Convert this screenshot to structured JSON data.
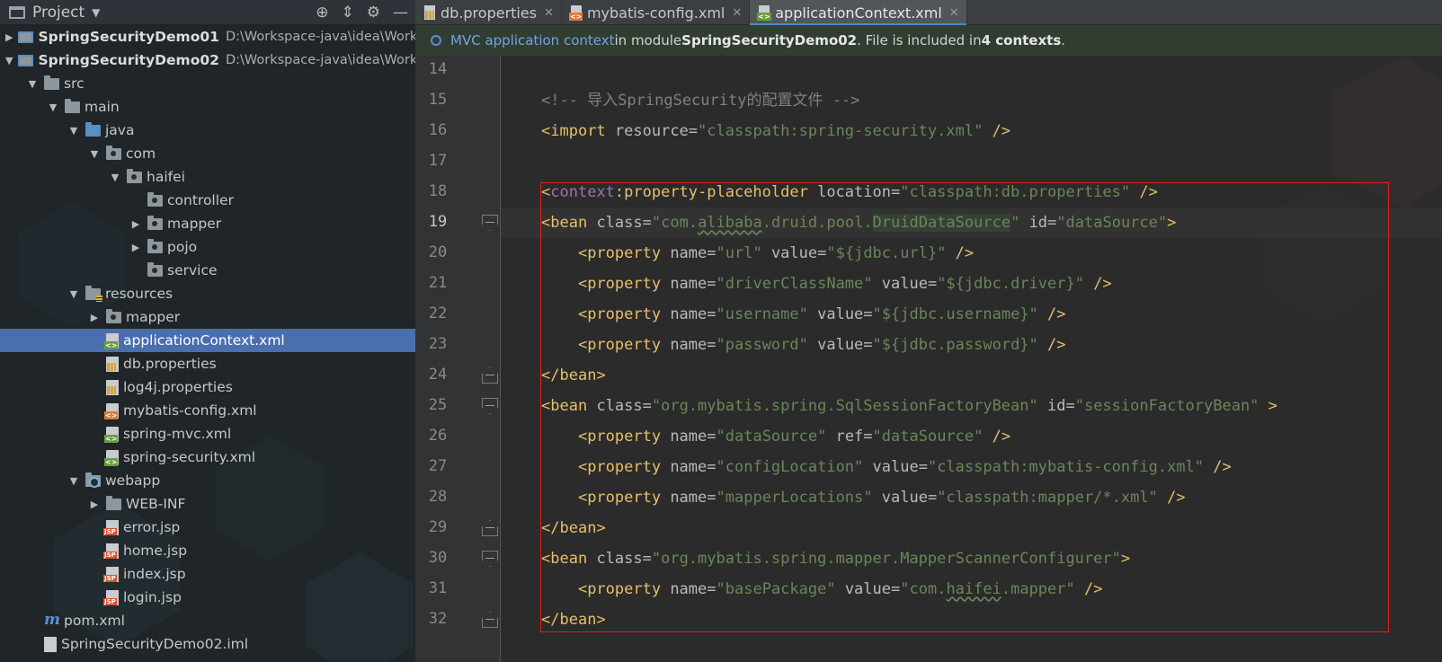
{
  "project_panel": {
    "header_label": "Project",
    "tree": [
      {
        "label": "SpringSecurityDemo01",
        "path": "D:\\Workspace-java\\idea\\Worksp",
        "bold": true,
        "depth": 0,
        "arrow": "right",
        "icon": "module-folder-icon"
      },
      {
        "label": "SpringSecurityDemo02",
        "path": "D:\\Workspace-java\\idea\\Worksp",
        "bold": true,
        "depth": 0,
        "arrow": "down",
        "icon": "module-folder-icon"
      },
      {
        "label": "src",
        "depth": 1,
        "arrow": "down",
        "icon": "folder-icon"
      },
      {
        "label": "main",
        "depth": 2,
        "arrow": "down",
        "icon": "folder-icon"
      },
      {
        "label": "java",
        "depth": 3,
        "arrow": "down",
        "icon": "source-folder-icon"
      },
      {
        "label": "com",
        "depth": 4,
        "arrow": "down",
        "icon": "package-icon"
      },
      {
        "label": "haifei",
        "depth": 5,
        "arrow": "down",
        "icon": "package-icon"
      },
      {
        "label": "controller",
        "depth": 6,
        "arrow": "none",
        "icon": "package-icon"
      },
      {
        "label": "mapper",
        "depth": 6,
        "arrow": "right",
        "icon": "package-icon"
      },
      {
        "label": "pojo",
        "depth": 6,
        "arrow": "right",
        "icon": "package-icon"
      },
      {
        "label": "service",
        "depth": 6,
        "arrow": "none",
        "icon": "package-icon"
      },
      {
        "label": "resources",
        "depth": 3,
        "arrow": "down",
        "icon": "resources-folder-icon"
      },
      {
        "label": "mapper",
        "depth": 4,
        "arrow": "right",
        "icon": "package-icon"
      },
      {
        "label": "applicationContext.xml",
        "depth": 4,
        "arrow": "none",
        "icon": "spring-xml-file-icon",
        "selected": true
      },
      {
        "label": "db.properties",
        "depth": 4,
        "arrow": "none",
        "icon": "properties-file-icon"
      },
      {
        "label": "log4j.properties",
        "depth": 4,
        "arrow": "none",
        "icon": "properties-file-icon"
      },
      {
        "label": "mybatis-config.xml",
        "depth": 4,
        "arrow": "none",
        "icon": "xml-file-icon"
      },
      {
        "label": "spring-mvc.xml",
        "depth": 4,
        "arrow": "none",
        "icon": "spring-xml-file-icon"
      },
      {
        "label": "spring-security.xml",
        "depth": 4,
        "arrow": "none",
        "icon": "spring-xml-file-icon"
      },
      {
        "label": "webapp",
        "depth": 3,
        "arrow": "down",
        "icon": "web-folder-icon"
      },
      {
        "label": "WEB-INF",
        "depth": 4,
        "arrow": "right",
        "icon": "folder-icon"
      },
      {
        "label": "error.jsp",
        "depth": 4,
        "arrow": "none",
        "icon": "jsp-file-icon"
      },
      {
        "label": "home.jsp",
        "depth": 4,
        "arrow": "none",
        "icon": "jsp-file-icon"
      },
      {
        "label": "index.jsp",
        "depth": 4,
        "arrow": "none",
        "icon": "jsp-file-icon"
      },
      {
        "label": "login.jsp",
        "depth": 4,
        "arrow": "none",
        "icon": "jsp-file-icon"
      },
      {
        "label": "pom.xml",
        "depth": 1,
        "arrow": "none",
        "icon": "maven-icon"
      },
      {
        "label": "SpringSecurityDemo02.iml",
        "depth": 1,
        "arrow": "none",
        "icon": "iml-file-icon"
      }
    ]
  },
  "tabs": [
    {
      "label": "db.properties",
      "icon": "properties-file-icon",
      "active": false
    },
    {
      "label": "mybatis-config.xml",
      "icon": "xml-file-icon",
      "active": false
    },
    {
      "label": "applicationContext.xml",
      "icon": "spring-xml-file-icon",
      "active": true
    }
  ],
  "notice": {
    "link": "MVC application context",
    "text1": " in module ",
    "module": "SpringSecurityDemo02",
    "text2": ". File is included in ",
    "count": "4 contexts",
    "text3": "."
  },
  "code_lines": [
    {
      "n": "14",
      "tokens": []
    },
    {
      "n": "15",
      "tokens": [
        {
          "t": "<!-- 导入SpringSecurity的配置文件 -->",
          "c": "t-cmt"
        }
      ]
    },
    {
      "n": "16",
      "tokens": [
        {
          "t": "<",
          "c": "t-br"
        },
        {
          "t": "import",
          "c": "t-tag"
        },
        {
          "t": " resource",
          "c": "t-attr"
        },
        {
          "t": "=",
          "c": "t-attr"
        },
        {
          "t": "\"classpath:spring-security.xml\"",
          "c": "t-str"
        },
        {
          "t": " />",
          "c": "t-br"
        }
      ]
    },
    {
      "n": "17",
      "tokens": []
    },
    {
      "n": "18",
      "tokens": [
        {
          "t": "<",
          "c": "t-br"
        },
        {
          "t": "context",
          "c": "t-ns"
        },
        {
          "t": ":property-placeholder",
          "c": "t-tag"
        },
        {
          "t": " location",
          "c": "t-attr"
        },
        {
          "t": "=",
          "c": "t-attr"
        },
        {
          "t": "\"classpath:db.properties\"",
          "c": "t-str"
        },
        {
          "t": " />",
          "c": "t-br"
        }
      ]
    },
    {
      "n": "19",
      "current": true,
      "tokens": [
        {
          "t": "<",
          "c": "t-br"
        },
        {
          "t": "bean",
          "c": "t-tag"
        },
        {
          "t": " class",
          "c": "t-attr"
        },
        {
          "t": "=",
          "c": "t-attr"
        },
        {
          "t": "\"com.",
          "c": "t-str"
        },
        {
          "t": "alibaba",
          "c": "t-str t-wavy"
        },
        {
          "t": ".druid.pool.",
          "c": "t-str"
        },
        {
          "t": "DruidDataSource",
          "c": "t-str t-hl"
        },
        {
          "t": "\"",
          "c": "t-str"
        },
        {
          "t": " id",
          "c": "t-attr"
        },
        {
          "t": "=",
          "c": "t-attr"
        },
        {
          "t": "\"dataSource\"",
          "c": "t-str"
        },
        {
          "t": ">",
          "c": "t-br"
        }
      ]
    },
    {
      "n": "20",
      "tokens": [
        {
          "t": "    <",
          "c": "t-br"
        },
        {
          "t": "property",
          "c": "t-tag"
        },
        {
          "t": " name",
          "c": "t-attr"
        },
        {
          "t": "=",
          "c": "t-attr"
        },
        {
          "t": "\"url\"",
          "c": "t-str"
        },
        {
          "t": " value",
          "c": "t-attr"
        },
        {
          "t": "=",
          "c": "t-attr"
        },
        {
          "t": "\"${jdbc.url}\"",
          "c": "t-str"
        },
        {
          "t": " />",
          "c": "t-br"
        }
      ]
    },
    {
      "n": "21",
      "tokens": [
        {
          "t": "    <",
          "c": "t-br"
        },
        {
          "t": "property",
          "c": "t-tag"
        },
        {
          "t": " name",
          "c": "t-attr"
        },
        {
          "t": "=",
          "c": "t-attr"
        },
        {
          "t": "\"driverClassName\"",
          "c": "t-str"
        },
        {
          "t": " value",
          "c": "t-attr"
        },
        {
          "t": "=",
          "c": "t-attr"
        },
        {
          "t": "\"${jdbc.driver}\"",
          "c": "t-str"
        },
        {
          "t": " />",
          "c": "t-br"
        }
      ]
    },
    {
      "n": "22",
      "tokens": [
        {
          "t": "    <",
          "c": "t-br"
        },
        {
          "t": "property",
          "c": "t-tag"
        },
        {
          "t": " name",
          "c": "t-attr"
        },
        {
          "t": "=",
          "c": "t-attr"
        },
        {
          "t": "\"username\"",
          "c": "t-str"
        },
        {
          "t": " value",
          "c": "t-attr"
        },
        {
          "t": "=",
          "c": "t-attr"
        },
        {
          "t": "\"${jdbc.username}\"",
          "c": "t-str"
        },
        {
          "t": " />",
          "c": "t-br"
        }
      ]
    },
    {
      "n": "23",
      "tokens": [
        {
          "t": "    <",
          "c": "t-br"
        },
        {
          "t": "property",
          "c": "t-tag"
        },
        {
          "t": " name",
          "c": "t-attr"
        },
        {
          "t": "=",
          "c": "t-attr"
        },
        {
          "t": "\"password\"",
          "c": "t-str"
        },
        {
          "t": " value",
          "c": "t-attr"
        },
        {
          "t": "=",
          "c": "t-attr"
        },
        {
          "t": "\"${jdbc.password}\"",
          "c": "t-str"
        },
        {
          "t": " />",
          "c": "t-br"
        }
      ]
    },
    {
      "n": "24",
      "tokens": [
        {
          "t": "</",
          "c": "t-br"
        },
        {
          "t": "bean",
          "c": "t-tag"
        },
        {
          "t": ">",
          "c": "t-br"
        }
      ]
    },
    {
      "n": "25",
      "tokens": [
        {
          "t": "<",
          "c": "t-br"
        },
        {
          "t": "bean",
          "c": "t-tag"
        },
        {
          "t": " class",
          "c": "t-attr"
        },
        {
          "t": "=",
          "c": "t-attr"
        },
        {
          "t": "\"org.mybatis.spring.SqlSessionFactoryBean\"",
          "c": "t-str"
        },
        {
          "t": " id",
          "c": "t-attr"
        },
        {
          "t": "=",
          "c": "t-attr"
        },
        {
          "t": "\"sessionFactoryBean\"",
          "c": "t-str"
        },
        {
          "t": " >",
          "c": "t-br"
        }
      ]
    },
    {
      "n": "26",
      "tokens": [
        {
          "t": "    <",
          "c": "t-br"
        },
        {
          "t": "property",
          "c": "t-tag"
        },
        {
          "t": " name",
          "c": "t-attr"
        },
        {
          "t": "=",
          "c": "t-attr"
        },
        {
          "t": "\"dataSource\"",
          "c": "t-str"
        },
        {
          "t": " ref",
          "c": "t-attr"
        },
        {
          "t": "=",
          "c": "t-attr"
        },
        {
          "t": "\"dataSource\"",
          "c": "t-str"
        },
        {
          "t": " />",
          "c": "t-br"
        }
      ]
    },
    {
      "n": "27",
      "tokens": [
        {
          "t": "    <",
          "c": "t-br"
        },
        {
          "t": "property",
          "c": "t-tag"
        },
        {
          "t": " name",
          "c": "t-attr"
        },
        {
          "t": "=",
          "c": "t-attr"
        },
        {
          "t": "\"configLocation\"",
          "c": "t-str"
        },
        {
          "t": " value",
          "c": "t-attr"
        },
        {
          "t": "=",
          "c": "t-attr"
        },
        {
          "t": "\"classpath:mybatis-config.xml\"",
          "c": "t-str"
        },
        {
          "t": " />",
          "c": "t-br"
        }
      ]
    },
    {
      "n": "28",
      "tokens": [
        {
          "t": "    <",
          "c": "t-br"
        },
        {
          "t": "property",
          "c": "t-tag"
        },
        {
          "t": " name",
          "c": "t-attr"
        },
        {
          "t": "=",
          "c": "t-attr"
        },
        {
          "t": "\"mapperLocations\"",
          "c": "t-str"
        },
        {
          "t": " value",
          "c": "t-attr"
        },
        {
          "t": "=",
          "c": "t-attr"
        },
        {
          "t": "\"classpath:mapper/*.xml\"",
          "c": "t-str"
        },
        {
          "t": " />",
          "c": "t-br"
        }
      ]
    },
    {
      "n": "29",
      "tokens": [
        {
          "t": "</",
          "c": "t-br"
        },
        {
          "t": "bean",
          "c": "t-tag"
        },
        {
          "t": ">",
          "c": "t-br"
        }
      ]
    },
    {
      "n": "30",
      "tokens": [
        {
          "t": "<",
          "c": "t-br"
        },
        {
          "t": "bean",
          "c": "t-tag"
        },
        {
          "t": " class",
          "c": "t-attr"
        },
        {
          "t": "=",
          "c": "t-attr"
        },
        {
          "t": "\"org.mybatis.spring.mapper.MapperScannerConfigurer\"",
          "c": "t-str"
        },
        {
          "t": ">",
          "c": "t-br"
        }
      ]
    },
    {
      "n": "31",
      "tokens": [
        {
          "t": "    <",
          "c": "t-br"
        },
        {
          "t": "property",
          "c": "t-tag"
        },
        {
          "t": " name",
          "c": "t-attr"
        },
        {
          "t": "=",
          "c": "t-attr"
        },
        {
          "t": "\"basePackage\"",
          "c": "t-str"
        },
        {
          "t": " value",
          "c": "t-attr"
        },
        {
          "t": "=",
          "c": "t-attr"
        },
        {
          "t": "\"com.",
          "c": "t-str"
        },
        {
          "t": "haifei",
          "c": "t-str t-wavy"
        },
        {
          "t": ".mapper\"",
          "c": "t-str"
        },
        {
          "t": " />",
          "c": "t-br"
        }
      ]
    },
    {
      "n": "32",
      "tokens": [
        {
          "t": "</",
          "c": "t-br"
        },
        {
          "t": "bean",
          "c": "t-tag"
        },
        {
          "t": ">",
          "c": "t-br"
        }
      ]
    }
  ],
  "fold_markers": [
    {
      "line": "19",
      "kind": "open"
    },
    {
      "line": "24",
      "kind": "close"
    },
    {
      "line": "25",
      "kind": "open"
    },
    {
      "line": "29",
      "kind": "close"
    },
    {
      "line": "30",
      "kind": "open"
    },
    {
      "line": "32",
      "kind": "close"
    }
  ],
  "colors": {
    "selection": "#4b6eaf",
    "tag": "#e8bf6a",
    "string": "#6a8759",
    "comment": "#808080",
    "namespace": "#9876aa",
    "annotation_box": "#e02020"
  }
}
